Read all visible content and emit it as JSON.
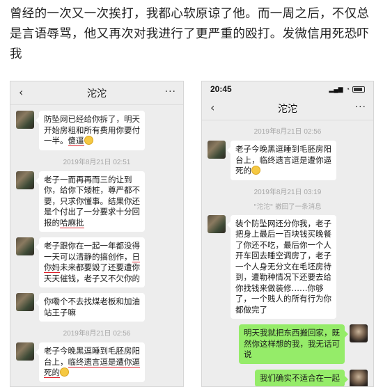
{
  "caption": {
    "text": "曾经的一次又一次挨打，我都心软原谅了他。而一周之后，不仅总是言语辱骂，他又再次对我进行了更严重的殴打。发微信用死恐吓我"
  },
  "left_phone": {
    "back_icon": "chevron-left-icon",
    "title": "沱沱",
    "more_icon": "more-icon",
    "messages": [
      {
        "pre": "防坠网已经给你拆了，明天开始房租和所有费用你要付一半。",
        "mark": "傻逼"
      },
      {
        "time": "2019年8月21日 02:51"
      },
      {
        "pre": "老子一而再再而三的让到你，给你下矮桩，尊严都不要，只求你懂事。结果你还是个付出了一分要求十分回报的",
        "mark": "哈麻批"
      },
      {
        "pre": "老子跟你在一起一年都没得一天可以清静的搞创作，",
        "mark": "日你妈",
        "post": "未来都要毁了还要遭你天天催钱，老子又不欠你的"
      },
      {
        "pre": "你嘞个不去找煤老板和加油站王子嘛"
      },
      {
        "time": "2019年8月21日 02:56"
      },
      {
        "pre": "老子今晚黑逗睡到毛胚房阳台上，",
        "mark": "临终遗言逗是遭你逼死的"
      }
    ]
  },
  "right_phone": {
    "status_time": "20:45",
    "back_icon": "chevron-left-icon",
    "title": "沱沱",
    "more_icon": "more-icon",
    "messages": [
      {
        "time": "2019年8月21日 02:56"
      },
      {
        "pre": "老子今晚黑逗睡到毛胚房阳台上，临终遗言逗是遭你逼死的"
      },
      {
        "time": "2019年8月21日 03:19"
      },
      {
        "recall": "\"沱沱\" 撤回了一条消息"
      },
      {
        "pre": "装个防坠网还分你我，老子把身上最后一百块钱买晚餐了你还不吃，最后你一个人开车回去睡空调房了，老子一个人身无分文在毛坯房待到，遭勒种情况下还要去给你找钱来做装修……你够了，一个贱人的所有行为你都做完了"
      },
      {
        "self": "明天我就把东西搬回家，既然你这样想的我，我无话可说"
      },
      {
        "self": "我们确实不适合在一起"
      }
    ]
  }
}
